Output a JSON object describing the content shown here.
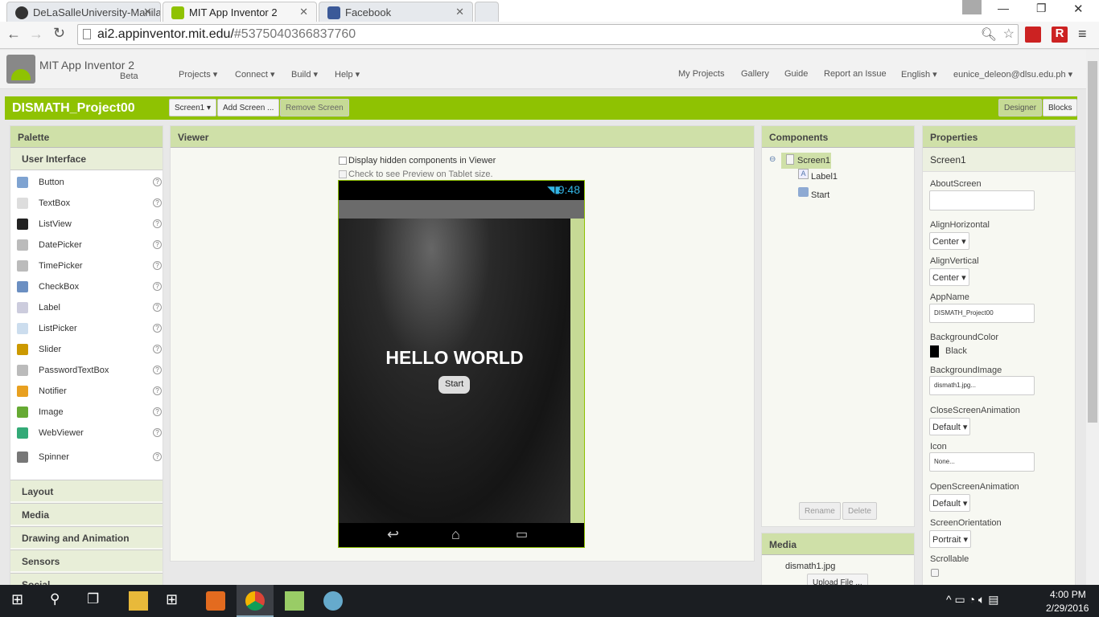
{
  "browser": {
    "tabs": [
      {
        "label": "DeLaSalleUniversity-Manila",
        "icon": "github-icon"
      },
      {
        "label": "MIT App Inventor 2",
        "icon": "app-inventor-icon",
        "active": true
      },
      {
        "label": "Facebook",
        "icon": "facebook-icon"
      }
    ],
    "url_host": "ai2.appinventor.mit.edu/",
    "url_hash": "#5375040366837760"
  },
  "header": {
    "app_title": "MIT App Inventor 2",
    "beta": "Beta",
    "menus": [
      "Projects ▾",
      "Connect ▾",
      "Build ▾",
      "Help ▾"
    ],
    "links": [
      "My Projects",
      "Gallery",
      "Guide",
      "Report an Issue",
      "English ▾",
      "eunice_deleon@dlsu.edu.ph ▾"
    ]
  },
  "project": {
    "name": "DISMATH_Project00",
    "screen_select": "Screen1 ▾",
    "add_screen": "Add Screen ...",
    "remove_screen": "Remove Screen",
    "designer": "Designer",
    "blocks": "Blocks"
  },
  "palette": {
    "title": "Palette",
    "category": "User Interface",
    "items": [
      {
        "label": "Button",
        "color": "#7fa3d1"
      },
      {
        "label": "TextBox",
        "color": "#ddd"
      },
      {
        "label": "ListView",
        "color": "#222"
      },
      {
        "label": "DatePicker",
        "color": "#bbb"
      },
      {
        "label": "TimePicker",
        "color": "#bbb"
      },
      {
        "label": "CheckBox",
        "color": "#6b8fc2"
      },
      {
        "label": "Label",
        "color": "#ccd"
      },
      {
        "label": "ListPicker",
        "color": "#cde"
      },
      {
        "label": "Slider",
        "color": "#c90"
      },
      {
        "label": "PasswordTextBox",
        "color": "#bbb"
      },
      {
        "label": "Notifier",
        "color": "#e8a020"
      },
      {
        "label": "Image",
        "color": "#6a3"
      },
      {
        "label": "WebViewer",
        "color": "#3a7"
      },
      {
        "label": "Spinner",
        "color": "#777"
      }
    ],
    "help": "?",
    "categories": [
      "Layout",
      "Media",
      "Drawing and Animation",
      "Sensors",
      "Social"
    ]
  },
  "viewer": {
    "title": "Viewer",
    "hidden_check": "Display hidden components in Viewer",
    "tablet_check": "Check to see Preview on Tablet size.",
    "time": "9:48",
    "label_text": "HELLO WORLD",
    "button_text": "Start"
  },
  "components": {
    "title": "Components",
    "tree": [
      "Screen1",
      "Label1",
      "Start"
    ],
    "rename": "Rename",
    "delete": "Delete"
  },
  "media": {
    "title": "Media",
    "file": "dismath1.jpg",
    "upload": "Upload File ..."
  },
  "properties": {
    "title": "Properties",
    "subject": "Screen1",
    "about_label": "AboutScreen",
    "about_value": "",
    "alignh_label": "AlignHorizontal",
    "alignh_value": "Center ▾",
    "alignv_label": "AlignVertical",
    "alignv_value": "Center ▾",
    "appname_label": "AppName",
    "appname_value": "DISMATH_Project00",
    "bgcolor_label": "BackgroundColor",
    "bgcolor_value": "Black",
    "bgimage_label": "BackgroundImage",
    "bgimage_value": "dismath1.jpg...",
    "close_label": "CloseScreenAnimation",
    "close_value": "Default ▾",
    "icon_label": "Icon",
    "icon_value": "None...",
    "open_label": "OpenScreenAnimation",
    "open_value": "Default ▾",
    "orient_label": "ScreenOrientation",
    "orient_value": "Portrait ▾",
    "scroll_label": "Scrollable",
    "scroll_value": false
  },
  "taskbar": {
    "time": "4:00 PM",
    "date": "2/29/2016"
  },
  "colors": {
    "accent": "#8fc202",
    "panel_header": "#cfe0a8"
  }
}
